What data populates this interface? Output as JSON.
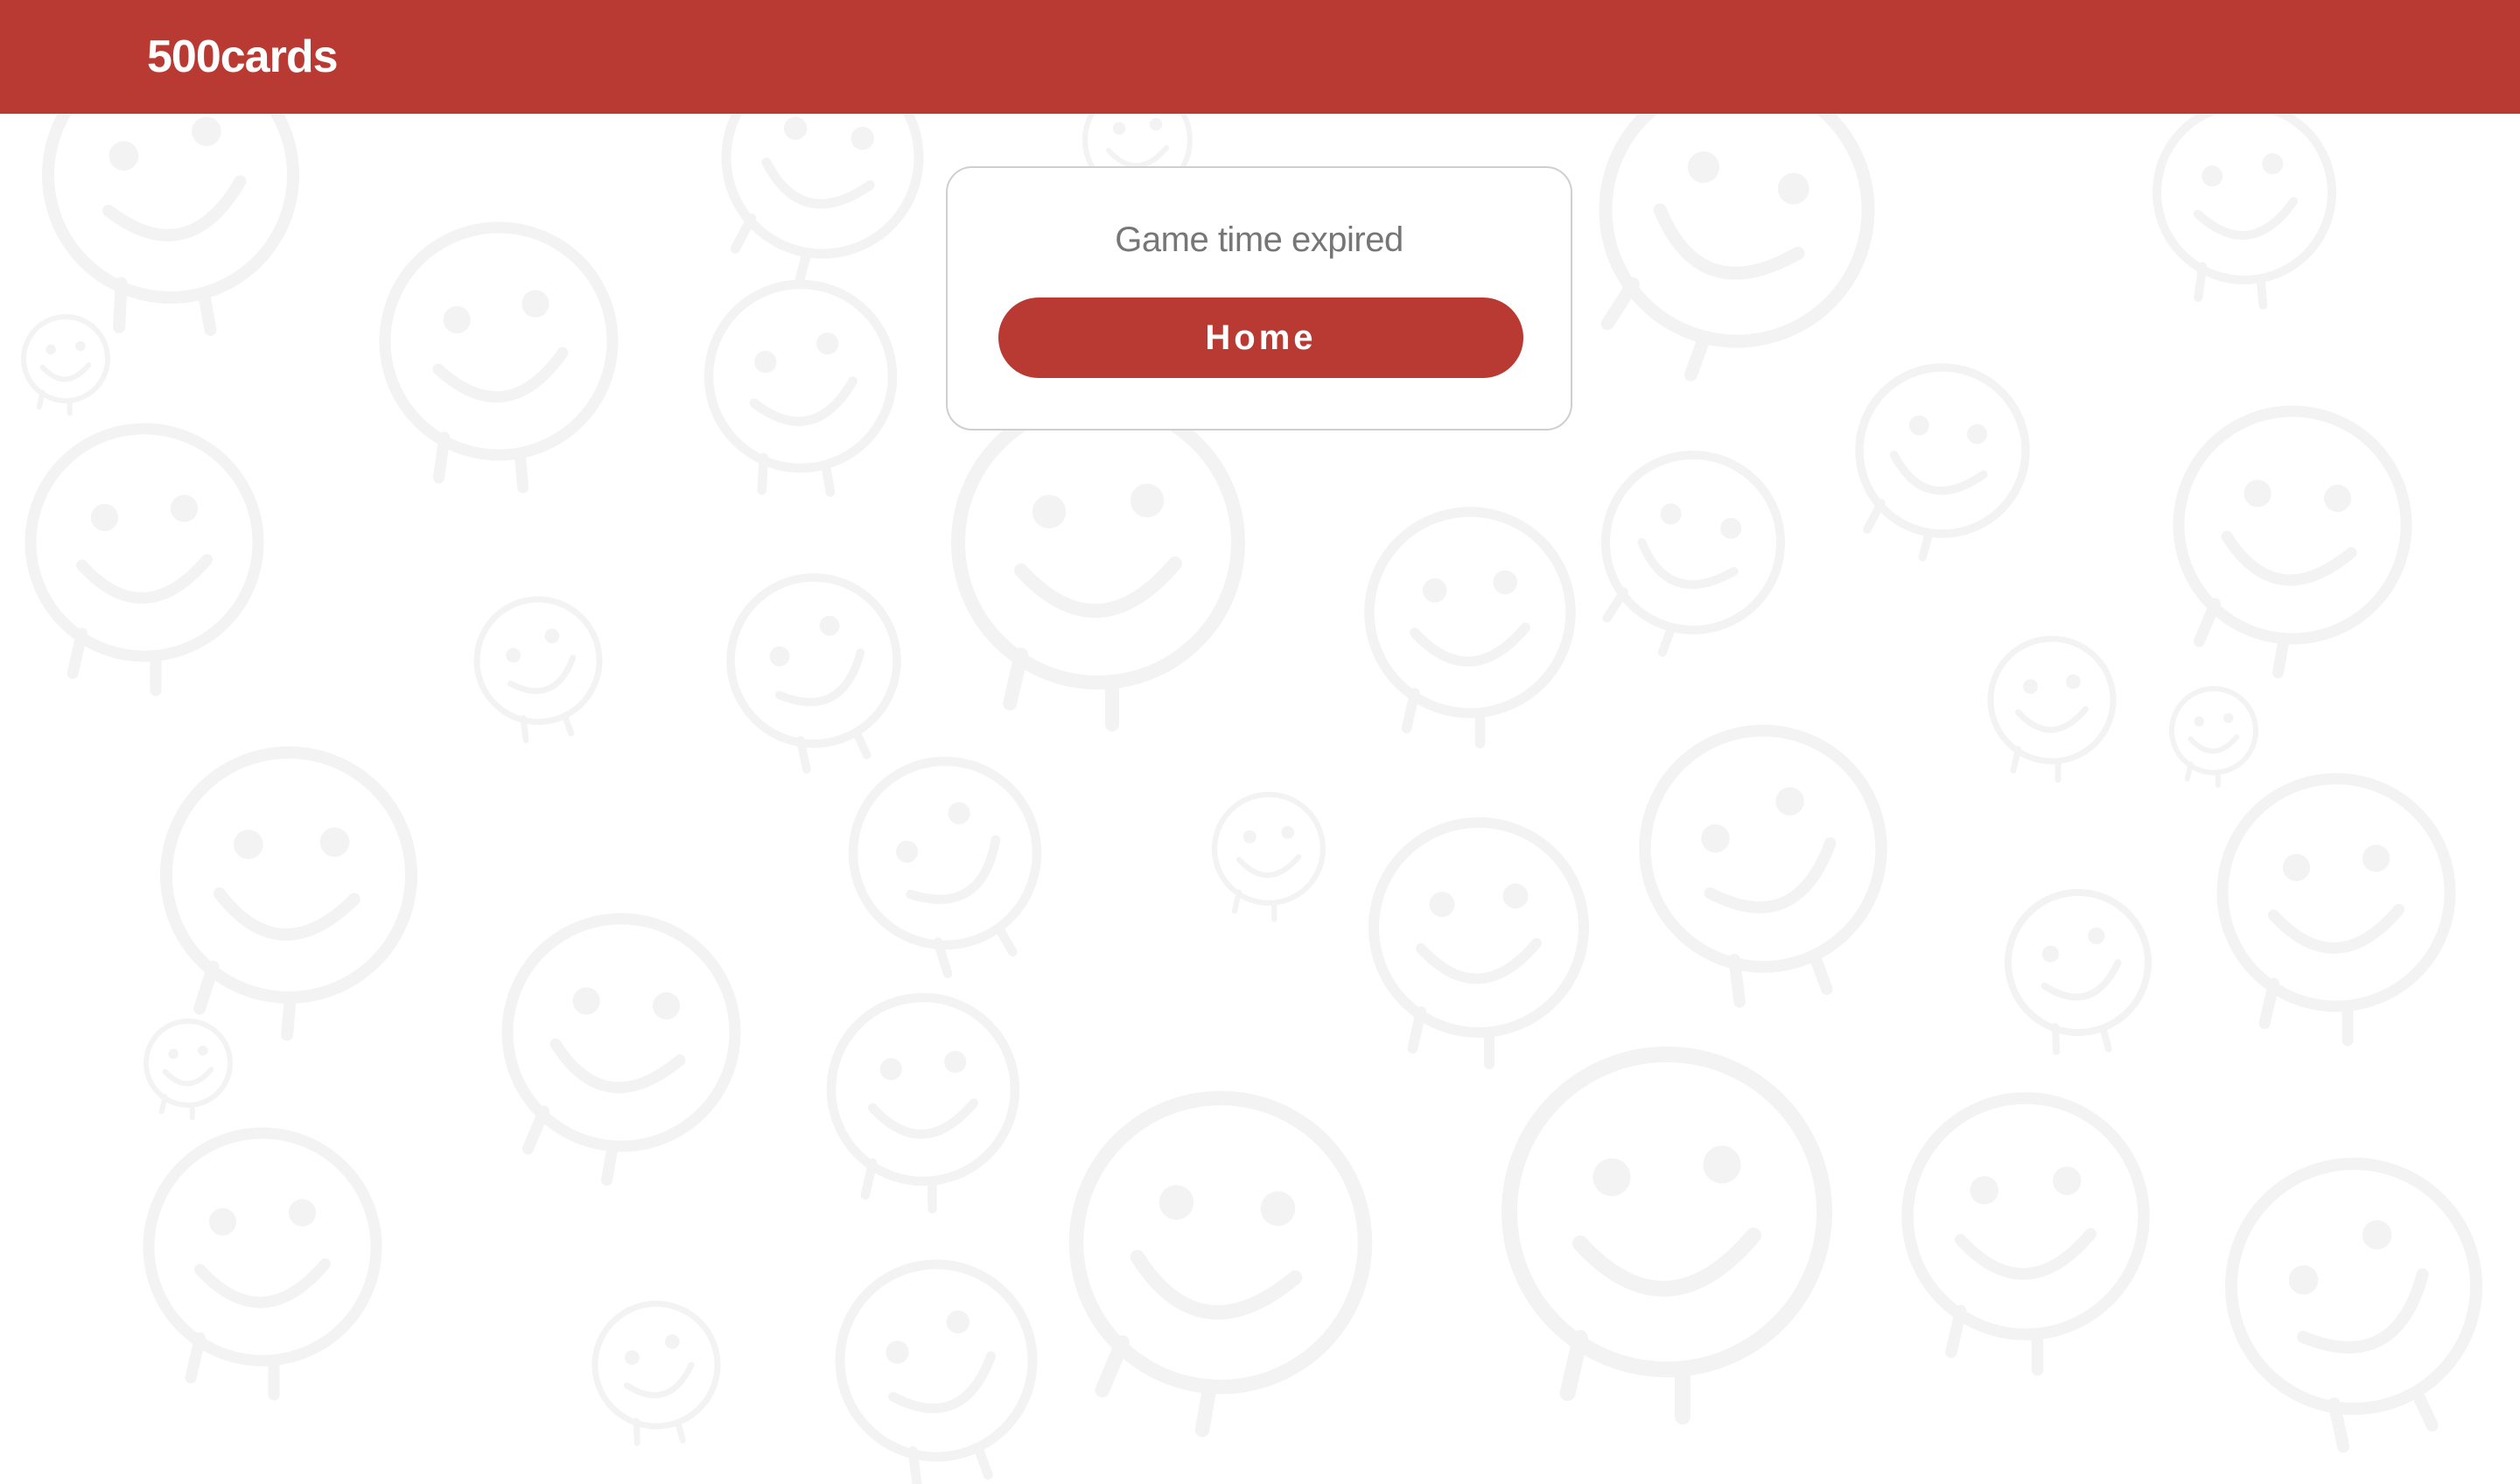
{
  "theme": {
    "brand_color": "#b83a33",
    "background_color": "#ffffff",
    "pattern_color": "#f3f3f3"
  },
  "navbar": {
    "brand": "500cards"
  },
  "dialog": {
    "message": "Game time expired",
    "home_button_label": "Home"
  },
  "background": {
    "pattern_icon": "smiley-face-icon"
  }
}
